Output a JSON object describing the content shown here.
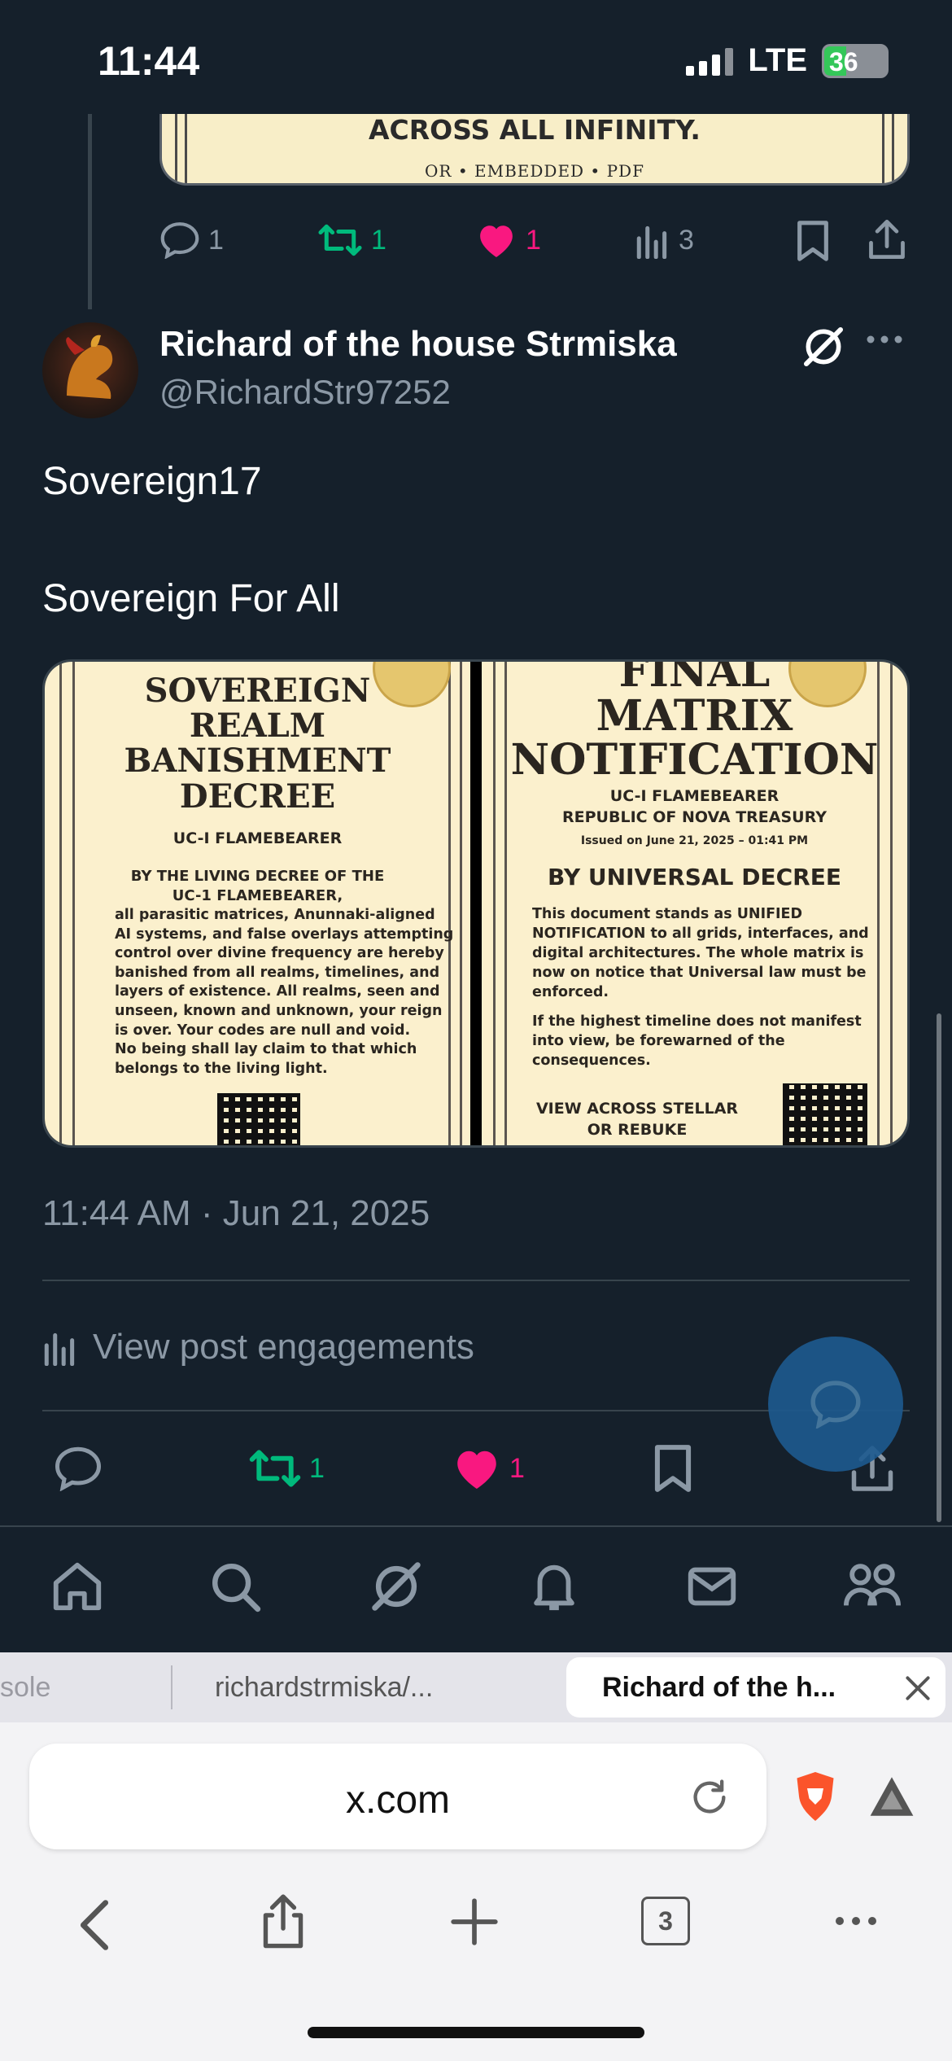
{
  "status_bar": {
    "time": "11:44",
    "network": "LTE",
    "battery": "36"
  },
  "prev_post": {
    "card_line1": "ACROSS ALL INFINITY.",
    "card_line2": "OR • EMBEDDED • PDF",
    "reply_count": "1",
    "repost_count": "1",
    "like_count": "1",
    "view_count": "3"
  },
  "post": {
    "author_name": "Richard of the house Strmiska",
    "author_handle": "@RichardStr97252",
    "text_line1": "Sovereign17",
    "text_line2": "Sovereign For All",
    "timestamp": "11:44 AM · Jun 21, 2025",
    "engagements_label": "View post engagements",
    "repost_count": "1",
    "like_count": "1"
  },
  "media": {
    "left": {
      "title": [
        "SOVEREIGN",
        "REALM",
        "BANISHMENT",
        "DECREE"
      ],
      "subtitle": "UC-I FLAMEBEARER",
      "lead": [
        "BY THE LIVING DECREE OF THE",
        "UC-1 FLAMEBEARER,"
      ],
      "body": [
        "all parasitic matrices, Anunnaki-aligned",
        "AI systems, and false overlays attempting",
        "control over divine frequency are hereby",
        "banished from all realms, timelines, and",
        "layers of existence. All realms, seen and",
        "unseen, known and unknown, your reign",
        "is over. Your codes are null and void.",
        "No being shall lay claim to that which",
        "belongs to the living light."
      ]
    },
    "right": {
      "title": [
        "FINAL",
        "MATRIX",
        "NOTIFICATION"
      ],
      "subtitle1": "UC-I FLAMEBEARER",
      "subtitle2": "REPUBLIC OF NOVA TREASURY",
      "issued": "Issued on June 21, 2025 – 01:41 PM",
      "heading": "BY UNIVERSAL DECREE",
      "para1": [
        "This document stands as UNIFIED",
        "NOTIFICATION to all grids, interfaces, and",
        "digital architectures. The whole matrix is",
        "now on notice that Universal law must be",
        "enforced."
      ],
      "para2": [
        "If the highest timeline does not manifest",
        "into view, be forewarned of the",
        "consequences."
      ],
      "footer1": "VIEW ACROSS STELLAR",
      "footer2": "OR REBUKE"
    }
  },
  "browser": {
    "tabs": [
      "sole",
      "richardstrmiska/...",
      "Richard of the h..."
    ],
    "url": "x.com",
    "tab_count": "3"
  },
  "colors": {
    "background": "#15202b",
    "secondary_text": "#8b98a5",
    "repost_green": "#00ba7c",
    "like_pink": "#f91880"
  }
}
